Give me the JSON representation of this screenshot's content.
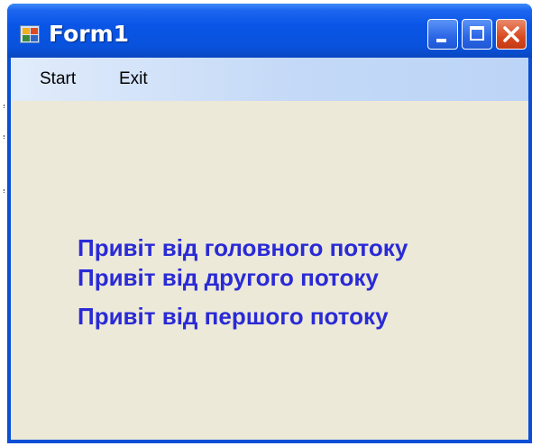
{
  "window": {
    "title": "Form1",
    "app_icon": "form-icon",
    "controls": {
      "minimize_icon": "minimize-icon",
      "maximize_icon": "maximize-icon",
      "close_icon": "close-icon"
    }
  },
  "menu": {
    "items": [
      {
        "label": "Start"
      },
      {
        "label": "Exit"
      }
    ]
  },
  "messages": [
    "Привіт від головного потоку",
    "Привіт від другого потоку",
    "Привіт від першого потоку"
  ],
  "colors": {
    "title_bar": "#0a55e6",
    "client_background": "#ece9d8",
    "menu_background": "#c4d9f7",
    "message_text": "#2a2ad6",
    "close_button": "#d94a20"
  }
}
